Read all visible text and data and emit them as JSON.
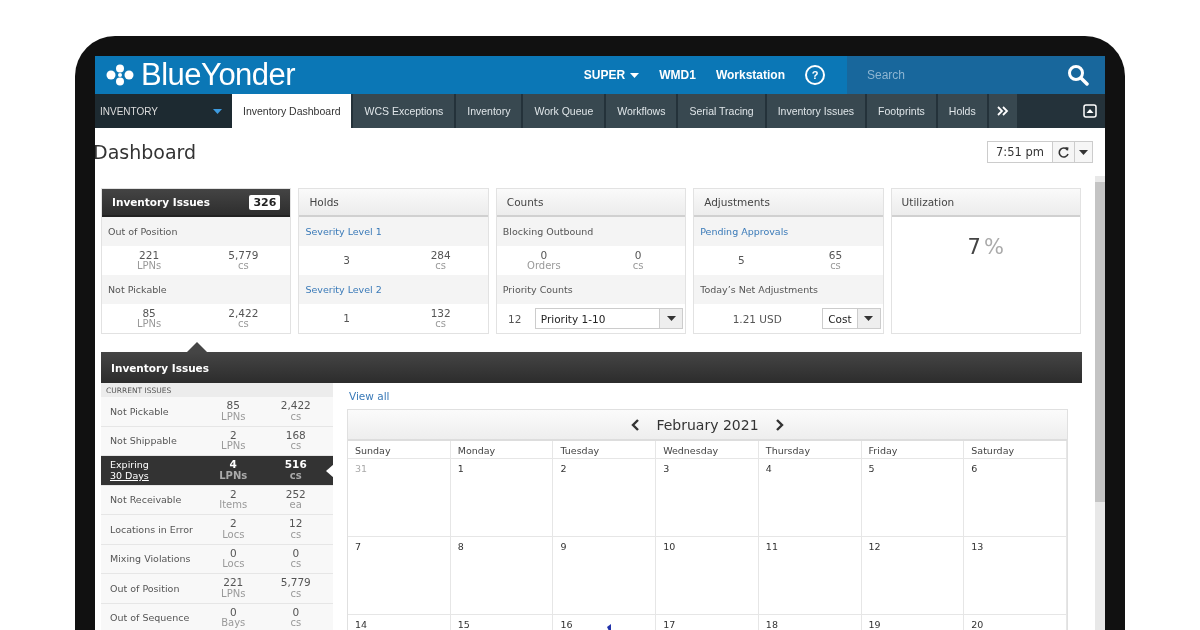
{
  "header": {
    "logo": "BlueYonder",
    "nav": [
      {
        "label": "SUPER",
        "dropdown": true
      },
      {
        "label": "WMD1",
        "dropdown": false
      },
      {
        "label": "Workstation",
        "dropdown": false
      }
    ],
    "help": "?",
    "search": {
      "placeholder": "Search"
    }
  },
  "module": {
    "label": "INVENTORY"
  },
  "tabs": [
    {
      "label": "Inventory Dashboard",
      "selected": true
    },
    {
      "label": "WCS Exceptions",
      "selected": false
    },
    {
      "label": "Inventory",
      "selected": false
    },
    {
      "label": "Work Queue",
      "selected": false
    },
    {
      "label": "Workflows",
      "selected": false
    },
    {
      "label": "Serial Tracing",
      "selected": false
    },
    {
      "label": "Inventory Issues",
      "selected": false
    },
    {
      "label": "Footprints",
      "selected": false
    },
    {
      "label": "Holds",
      "selected": false
    }
  ],
  "page_title": "Dashboard",
  "time": "7:51 pm",
  "cards": [
    {
      "kind": "sections",
      "title": "Inventory Issues",
      "badge": "326",
      "selected": true,
      "sections": [
        {
          "kind": "values",
          "label": "Out of Position",
          "link": false,
          "values": [
            {
              "value": "221",
              "unit": "LPNs"
            },
            {
              "value": "5,779",
              "unit": "cs"
            }
          ]
        },
        {
          "kind": "values",
          "label": "Not Pickable",
          "link": false,
          "values": [
            {
              "value": "85",
              "unit": "LPNs"
            },
            {
              "value": "2,422",
              "unit": "cs"
            }
          ]
        }
      ]
    },
    {
      "kind": "sections",
      "title": "Holds",
      "selected": false,
      "sections": [
        {
          "kind": "values",
          "label": "Severity Level 1",
          "link": true,
          "values": [
            {
              "value": "3"
            },
            {
              "value": "284",
              "unit": "cs"
            }
          ]
        },
        {
          "kind": "values",
          "label": "Severity Level 2",
          "link": true,
          "values": [
            {
              "value": "1"
            },
            {
              "value": "132",
              "unit": "cs"
            }
          ]
        }
      ]
    },
    {
      "kind": "sections",
      "title": "Counts",
      "selected": false,
      "sections": [
        {
          "kind": "values",
          "label": "Blocking Outbound",
          "link": false,
          "values": [
            {
              "value": "0",
              "unit": "Orders"
            },
            {
              "value": "0",
              "unit": "cs"
            }
          ]
        },
        {
          "kind": "select",
          "label": "Priority Counts",
          "link": false,
          "value": "12",
          "select": "Priority 1-10"
        }
      ]
    },
    {
      "kind": "sections",
      "title": "Adjustments",
      "selected": false,
      "sections": [
        {
          "kind": "values",
          "label": "Pending Approvals",
          "link": true,
          "values": [
            {
              "value": "5"
            },
            {
              "value": "65",
              "unit": "cs"
            }
          ]
        },
        {
          "kind": "select",
          "label": "Today’s Net Adjustments",
          "link": false,
          "value": "1.21 USD",
          "select": "Cost"
        }
      ]
    },
    {
      "kind": "percent",
      "title": "Utilization",
      "selected": false,
      "value": "7",
      "unit": "%"
    }
  ],
  "panel": {
    "title": "Inventory Issues",
    "list_header": "CURRENT ISSUES",
    "issues": [
      {
        "label": "Not Pickable",
        "selected": false,
        "values": [
          {
            "value": "85",
            "unit": "LPNs"
          },
          {
            "value": "2,422",
            "unit": "cs"
          }
        ]
      },
      {
        "label": "Not Shippable",
        "selected": false,
        "values": [
          {
            "value": "2",
            "unit": "LPNs"
          },
          {
            "value": "168",
            "unit": "cs"
          }
        ]
      },
      {
        "label": "Expiring",
        "sublabel": "30 Days",
        "selected": true,
        "values": [
          {
            "value": "4",
            "unit": "LPNs"
          },
          {
            "value": "516",
            "unit": "cs"
          }
        ]
      },
      {
        "label": "Not Receivable",
        "selected": false,
        "values": [
          {
            "value": "2",
            "unit": "Items"
          },
          {
            "value": "252",
            "unit": "ea"
          }
        ]
      },
      {
        "label": "Locations in Error",
        "selected": false,
        "values": [
          {
            "value": "2",
            "unit": "Locs"
          },
          {
            "value": "12",
            "unit": "cs"
          }
        ]
      },
      {
        "label": "Mixing Violations",
        "selected": false,
        "values": [
          {
            "value": "0",
            "unit": "Locs"
          },
          {
            "value": "0",
            "unit": "cs"
          }
        ]
      },
      {
        "label": "Out of Position",
        "selected": false,
        "values": [
          {
            "value": "221",
            "unit": "LPNs"
          },
          {
            "value": "5,779",
            "unit": "cs"
          }
        ]
      },
      {
        "label": "Out of Sequence",
        "selected": false,
        "values": [
          {
            "value": "0",
            "unit": "Bays"
          },
          {
            "value": "0",
            "unit": "cs"
          }
        ]
      }
    ],
    "view_all": "View all",
    "calendar": {
      "month": "February 2021",
      "weekdays": [
        "Sunday",
        "Monday",
        "Tuesday",
        "Wednesday",
        "Thursday",
        "Friday",
        "Saturday"
      ],
      "weeks": [
        [
          {
            "day": "31",
            "other_month": true
          },
          {
            "day": "1",
            "other_month": false
          },
          {
            "day": "2",
            "other_month": false
          },
          {
            "day": "3",
            "other_month": false
          },
          {
            "day": "4",
            "other_month": false
          },
          {
            "day": "5",
            "other_month": false
          },
          {
            "day": "6",
            "other_month": false
          }
        ],
        [
          {
            "day": "7",
            "other_month": false
          },
          {
            "day": "8",
            "other_month": false
          },
          {
            "day": "9",
            "other_month": false
          },
          {
            "day": "10",
            "other_month": false
          },
          {
            "day": "11",
            "other_month": false
          },
          {
            "day": "12",
            "other_month": false
          },
          {
            "day": "13",
            "other_month": false
          }
        ],
        [
          {
            "day": "14",
            "other_month": false
          },
          {
            "day": "15",
            "other_month": false
          },
          {
            "day": "16",
            "other_month": false,
            "event": true
          },
          {
            "day": "17",
            "other_month": false
          },
          {
            "day": "18",
            "other_month": false
          },
          {
            "day": "19",
            "other_month": false
          },
          {
            "day": "20",
            "other_month": false
          }
        ]
      ]
    }
  }
}
